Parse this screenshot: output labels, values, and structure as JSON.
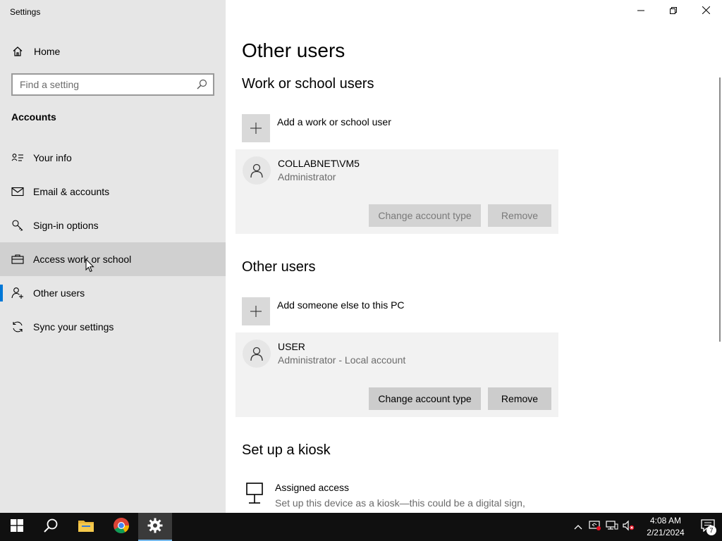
{
  "window": {
    "title": "Settings",
    "minimize_icon": "minimize-icon",
    "restore_icon": "restore-icon",
    "close_icon": "close-icon"
  },
  "sidebar": {
    "home_label": "Home",
    "search_placeholder": "Find a setting",
    "section_label": "Accounts",
    "items": [
      {
        "label": "Your info",
        "icon": "person-card-icon"
      },
      {
        "label": "Email & accounts",
        "icon": "mail-icon"
      },
      {
        "label": "Sign-in options",
        "icon": "key-icon"
      },
      {
        "label": "Access work or school",
        "icon": "briefcase-icon"
      },
      {
        "label": "Other users",
        "icon": "person-add-icon"
      },
      {
        "label": "Sync your settings",
        "icon": "sync-icon"
      }
    ],
    "hovered_item": "Access work or school",
    "selected_item": "Other users"
  },
  "main": {
    "page_title": "Other users",
    "work_section": {
      "heading": "Work or school users",
      "add_label": "Add a work or school user",
      "user": {
        "name": "COLLABNET\\VM5",
        "role": "Administrator",
        "change_label": "Change account type",
        "remove_label": "Remove"
      }
    },
    "other_section": {
      "heading": "Other users",
      "add_label": "Add someone else to this PC",
      "user": {
        "name": "USER",
        "role": "Administrator - Local account",
        "change_label": "Change account type",
        "remove_label": "Remove"
      }
    },
    "kiosk_section": {
      "heading": "Set up a kiosk",
      "title": "Assigned access",
      "description": "Set up this device as a kiosk—this could be a digital sign, interactive display, or public browser among other things."
    }
  },
  "taskbar": {
    "time": "4:08 AM",
    "date": "2/21/2024",
    "notification_count": "7"
  },
  "colors": {
    "accent": "#0078d7",
    "sidebar_bg": "#e6e6e6",
    "taskbar_bg": "#101010"
  }
}
